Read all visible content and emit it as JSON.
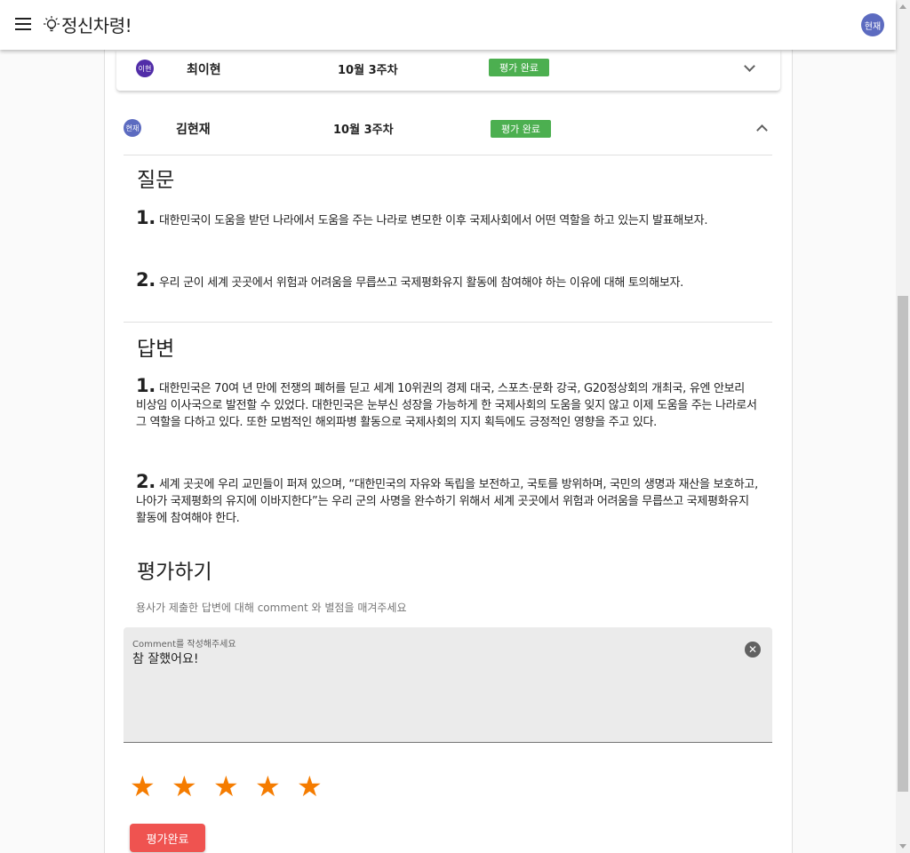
{
  "app": {
    "title": "정신차령!",
    "user_avatar": "현재"
  },
  "colors": {
    "accent_green": "#4caf50",
    "star_orange": "#f57c00",
    "submit_red": "#ef5350",
    "avatar_blue": "#5c6bc0",
    "avatar_purple": "#512da8"
  },
  "rows": [
    {
      "avatar": "이현",
      "name": "최이현",
      "week": "10월 3주차",
      "status": "평가 완료",
      "expanded": false
    },
    {
      "avatar": "현재",
      "name": "김현재",
      "week": "10월 3주차",
      "status": "평가 완료",
      "expanded": true
    }
  ],
  "questions": {
    "title": "질문",
    "items": [
      {
        "num": "1.",
        "text": "대한민국이 도움을 받던 나라에서 도움을 주는 나라로 변모한 이후 국제사회에서 어떤 역할을 하고 있는지 발표해보자."
      },
      {
        "num": "2.",
        "text": "우리 군이 세계 곳곳에서 위험과 어려움을 무릅쓰고 국제평화유지 활동에 참여해야 하는 이유에 대해 토의해보자."
      }
    ]
  },
  "answers": {
    "title": "답변",
    "items": [
      {
        "num": "1.",
        "text": "대한민국은 70여 년 만에 전쟁의 폐허를 딛고 세계 10위권의 경제 대국, 스포츠·문화 강국, G20정상회의 개최국, 유엔 안보리 비상임 이사국으로 발전할 수 있었다. 대한민국은 눈부신 성장을 가능하게 한 국제사회의 도움을 잊지 않고 이제 도움을 주는 나라로서 그 역할을 다하고 있다. 또한 모범적인 해외파병 활동으로 국제사회의 지지 획득에도 긍정적인 영향을 주고 있다."
      },
      {
        "num": "2.",
        "text": "세계 곳곳에 우리 교민들이 퍼져 있으며, “대한민국의 자유와 독립을 보전하고, 국토를 방위하며, 국민의 생명과 재산을 보호하고, 나아가 국제평화의 유지에 이바지한다”는 우리 군의 사명을 완수하기 위해서 세계 곳곳에서 위험과 어려움을 무릅쓰고 국제평화유지 활동에 참여해야 한다."
      }
    ]
  },
  "evaluation": {
    "title": "평가하기",
    "description": "용사가 제출한 답변에 대해 comment 와 별점을 매겨주세요",
    "comment_label": "Comment를 작성해주세요",
    "comment_value": "참 잘했어요!",
    "rating": 5,
    "rating_max": 5,
    "submit_label": "평가완료"
  }
}
